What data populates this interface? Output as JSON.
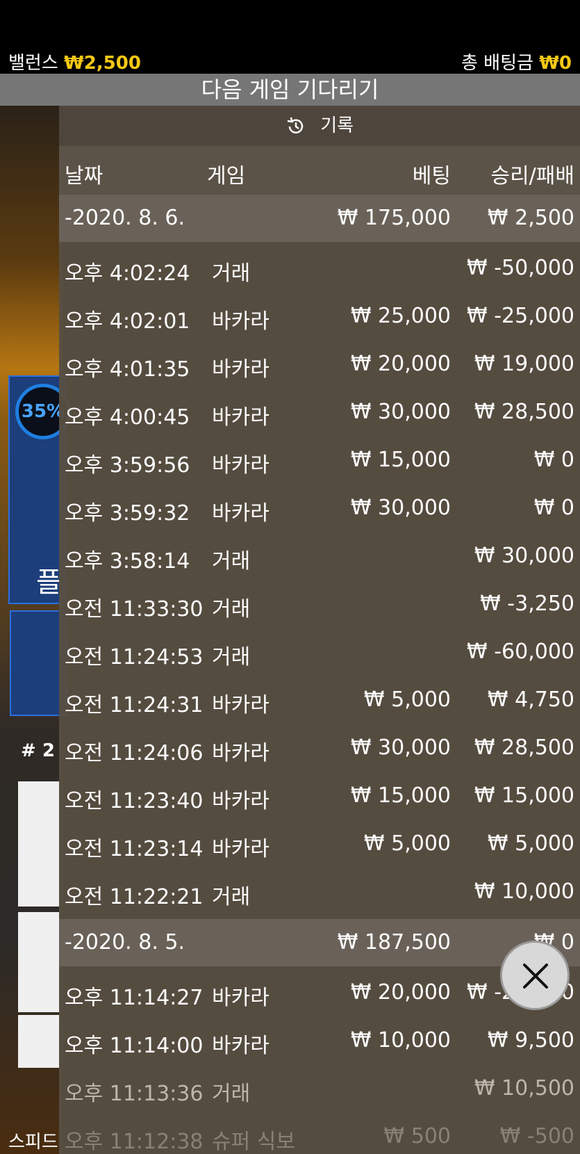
{
  "header": {
    "balance_label": "밸런스",
    "balance_value": "₩2,500",
    "total_bet_label": "총 배팅금",
    "total_bet_value": "₩0",
    "waiting_text": "다음 게임 기다리기"
  },
  "background": {
    "percent": "35%",
    "player_partial": "플",
    "round_partial": "# 2",
    "speed_partial": "스피드"
  },
  "history": {
    "title": "기록",
    "columns": {
      "date": "날짜",
      "game": "게임",
      "bet": "베팅",
      "winloss": "승리/패배"
    },
    "groups": [
      {
        "date": "-2020. 8. 6.",
        "bet": "₩ 175,000",
        "winloss": "₩ 2,500",
        "rows": [
          {
            "time": "오후 4:02:24",
            "game": "거래",
            "bet": "",
            "winloss": "₩ -50,000"
          },
          {
            "time": "오후 4:02:01",
            "game": "바카라",
            "bet": "₩ 25,000",
            "winloss": "₩ -25,000"
          },
          {
            "time": "오후 4:01:35",
            "game": "바카라",
            "bet": "₩ 20,000",
            "winloss": "₩ 19,000"
          },
          {
            "time": "오후 4:00:45",
            "game": "바카라",
            "bet": "₩ 30,000",
            "winloss": "₩ 28,500"
          },
          {
            "time": "오후 3:59:56",
            "game": "바카라",
            "bet": "₩ 15,000",
            "winloss": "₩ 0"
          },
          {
            "time": "오후 3:59:32",
            "game": "바카라",
            "bet": "₩ 30,000",
            "winloss": "₩ 0"
          },
          {
            "time": "오후 3:58:14",
            "game": "거래",
            "bet": "",
            "winloss": "₩ 30,000"
          },
          {
            "time": "오전 11:33:30",
            "game": "거래",
            "bet": "",
            "winloss": "₩ -3,250"
          },
          {
            "time": "오전 11:24:53",
            "game": "거래",
            "bet": "",
            "winloss": "₩ -60,000"
          },
          {
            "time": "오전 11:24:31",
            "game": "바카라",
            "bet": "₩ 5,000",
            "winloss": "₩ 4,750"
          },
          {
            "time": "오전 11:24:06",
            "game": "바카라",
            "bet": "₩ 30,000",
            "winloss": "₩ 28,500"
          },
          {
            "time": "오전 11:23:40",
            "game": "바카라",
            "bet": "₩ 15,000",
            "winloss": "₩ 15,000"
          },
          {
            "time": "오전 11:23:14",
            "game": "바카라",
            "bet": "₩ 5,000",
            "winloss": "₩ 5,000"
          },
          {
            "time": "오전 11:22:21",
            "game": "거래",
            "bet": "",
            "winloss": "₩ 10,000"
          }
        ]
      },
      {
        "date": "-2020. 8. 5.",
        "bet": "₩ 187,500",
        "winloss": "₩ 0",
        "rows": [
          {
            "time": "오후 11:14:27",
            "game": "바카라",
            "bet": "₩ 20,000",
            "winloss": "₩ -20,000"
          },
          {
            "time": "오후 11:14:00",
            "game": "바카라",
            "bet": "₩ 10,000",
            "winloss": "₩ 9,500"
          },
          {
            "time": "오후 11:13:36",
            "game": "거래",
            "bet": "",
            "winloss": "₩ 10,500"
          },
          {
            "time": "오후 11:12:38",
            "game": "슈퍼 식보",
            "bet": "₩ 500",
            "winloss": "₩ -500"
          }
        ]
      }
    ]
  },
  "colors": {
    "accent": "#f5c814",
    "panel": "#584e42",
    "blue": "#2b6fe0"
  }
}
